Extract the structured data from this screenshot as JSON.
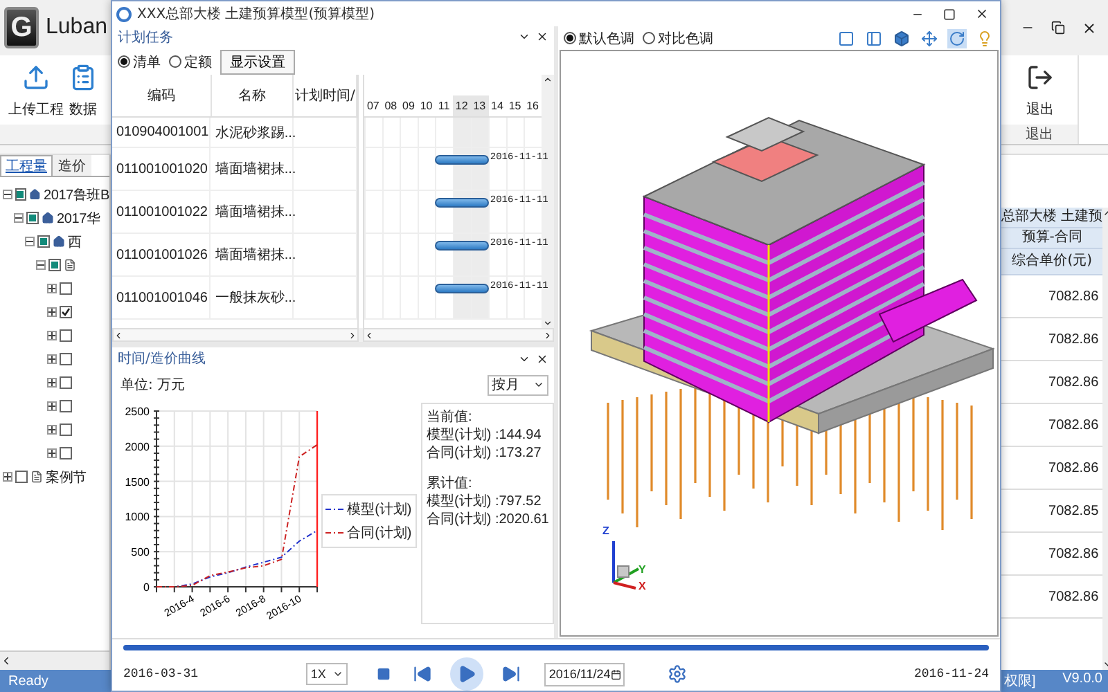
{
  "app": {
    "logo": "G",
    "title": "Luban",
    "ribbon": {
      "left_buttons": [
        {
          "label": "上传工程",
          "kind": "upload"
        },
        {
          "label": "数据",
          "kind": "data"
        }
      ],
      "right_button": {
        "label": "退出"
      },
      "right_group": "退出"
    },
    "tabs": [
      {
        "label": "工程量",
        "selected": true
      },
      {
        "label": "造价",
        "selected": false
      }
    ],
    "tree": [
      {
        "label": "2017鲁班B",
        "kind": "house",
        "checked": false,
        "partial": true,
        "expanded": true,
        "children": [
          {
            "label": "2017华",
            "kind": "house",
            "checked": false,
            "partial": true,
            "expanded": true,
            "children": [
              {
                "label": "西",
                "kind": "house",
                "checked": false,
                "partial": true,
                "expanded": true,
                "children": [
                  {
                    "kind": "doc",
                    "checked": false,
                    "partial": true,
                    "expanded": true,
                    "children": [
                      {
                        "checked": false,
                        "expanded": false
                      },
                      {
                        "checked": true,
                        "expanded": false
                      },
                      {
                        "checked": false,
                        "expanded": false
                      },
                      {
                        "checked": false,
                        "expanded": false
                      },
                      {
                        "checked": false,
                        "expanded": false
                      },
                      {
                        "checked": false,
                        "expanded": false
                      },
                      {
                        "checked": false,
                        "expanded": false
                      },
                      {
                        "checked": false,
                        "expanded": false
                      }
                    ]
                  }
                ]
              }
            ]
          }
        ]
      },
      {
        "label": "案例节",
        "kind": "doc",
        "checked": false,
        "expanded": false
      }
    ],
    "table": {
      "header_1": "总部大楼 土建预",
      "header_2": "预算-合同",
      "column": "综合单价(元)",
      "rows": [
        "7082.86",
        "7082.86",
        "7082.86",
        "7082.86",
        "7082.86",
        "7082.85",
        "7082.86",
        "7082.86"
      ]
    },
    "status_bar": {
      "left": "Ready",
      "middle": "权限]",
      "version": "V9.0.0"
    }
  },
  "window": {
    "title": "XXX总部大楼 土建预算模型(预算模型)",
    "plan_pane": {
      "title": "计划任务",
      "modes": [
        {
          "label": "清单",
          "selected": true
        },
        {
          "label": "定额",
          "selected": false
        }
      ],
      "settings_button": "显示设置",
      "columns": [
        "编码",
        "名称",
        "计划时间/"
      ],
      "days": [
        {
          "label": "07",
          "shaded": false
        },
        {
          "label": "08",
          "shaded": false
        },
        {
          "label": "09",
          "shaded": false
        },
        {
          "label": "10",
          "shaded": false
        },
        {
          "label": "11",
          "shaded": false
        },
        {
          "label": "12",
          "shaded": true
        },
        {
          "label": "13",
          "shaded": true
        },
        {
          "label": "14",
          "shaded": false
        },
        {
          "label": "15",
          "shaded": false
        },
        {
          "label": "16",
          "shaded": false
        }
      ],
      "rows": [
        {
          "code": "010904001001",
          "name": "水泥砂浆踢..."
        },
        {
          "code": "011001001020",
          "name": "墙面墙裙抹...",
          "bar_label": "2016-11-11"
        },
        {
          "code": "011001001022",
          "name": "墙面墙裙抹...",
          "bar_label": "2016-11-11"
        },
        {
          "code": "011001001026",
          "name": "墙面墙裙抹...",
          "bar_label": "2016-11-11"
        },
        {
          "code": "011001001046",
          "name": "一般抹灰砂...",
          "bar_label": "2016-11-11"
        }
      ]
    },
    "curve_pane": {
      "title": "时间/造价曲线",
      "unit": "单位: 万元",
      "period": "按月",
      "chart_data": {
        "type": "line",
        "categories": [
          null,
          null,
          "2016-4",
          null,
          "2016-6",
          null,
          "2016-8",
          null,
          "2016-10",
          null
        ],
        "ylim": [
          0,
          2500
        ],
        "yticks": [
          0,
          500,
          1000,
          1500,
          2000,
          2500
        ],
        "grid": true,
        "series": [
          {
            "name": "模型(计划)",
            "color": "#2233cc",
            "line_style": "dashdot",
            "values": [
              0,
              0,
              40,
              140,
              200,
              280,
              350,
              420,
              650,
              800
            ]
          },
          {
            "name": "合同(计划)",
            "color": "#cc2222",
            "line_style": "dashdot",
            "values": [
              0,
              0,
              20,
              160,
              210,
              270,
              300,
              390,
              1850,
              2020
            ]
          }
        ]
      },
      "info": {
        "current_title": "当前值:",
        "current_lines": [
          "模型(计划) :144.94",
          "合同(计划) :173.27"
        ],
        "total_title": "累计值:",
        "total_lines": [
          "模型(计划) :797.52",
          "合同(计划) :2020.61"
        ]
      }
    },
    "model_pane": {
      "color_modes": [
        {
          "label": "默认色调",
          "selected": true
        },
        {
          "label": "对比色调",
          "selected": false
        }
      ],
      "tools": [
        {
          "kind": "outline",
          "selected": false
        },
        {
          "kind": "front",
          "selected": false
        },
        {
          "kind": "solid",
          "selected": false
        },
        {
          "kind": "move",
          "selected": false
        },
        {
          "kind": "rotate",
          "selected": true
        },
        {
          "kind": "light",
          "selected": false
        }
      ],
      "axes": [
        "Z",
        "Y",
        "X"
      ]
    },
    "playback": {
      "level": 1,
      "start": "2016-03-31",
      "speed": "1X",
      "date": "2016/11/24",
      "end": "2016-11-24"
    }
  }
}
